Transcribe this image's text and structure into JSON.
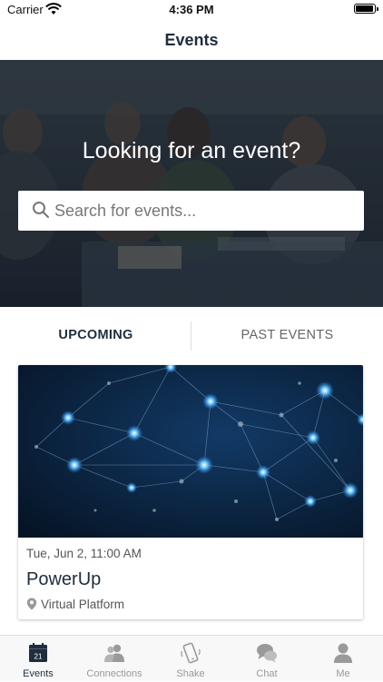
{
  "status_bar": {
    "carrier": "Carrier",
    "time": "4:36 PM"
  },
  "nav": {
    "title": "Events"
  },
  "hero": {
    "headline": "Looking for an event?",
    "search_placeholder": "Search for events..."
  },
  "tabs": [
    {
      "label": "UPCOMING",
      "selected": true
    },
    {
      "label": "PAST EVENTS",
      "selected": false
    }
  ],
  "events": [
    {
      "date": "Tue, Jun 2, 11:00 AM",
      "title": "PowerUp",
      "location": "Virtual Platform"
    }
  ],
  "tab_bar": {
    "items": [
      {
        "label": "Events",
        "icon": "calendar-icon",
        "badge": "21",
        "active": true
      },
      {
        "label": "Connections",
        "icon": "people-icon",
        "active": false
      },
      {
        "label": "Shake",
        "icon": "shake-phone-icon",
        "active": false
      },
      {
        "label": "Chat",
        "icon": "chat-bubbles-icon",
        "active": false
      },
      {
        "label": "Me",
        "icon": "person-icon",
        "active": false
      }
    ]
  },
  "colors": {
    "accent": "#1f2d3d",
    "inactive": "#999999",
    "hero_tint": "#25303a",
    "network_bg": "#0a1f3a"
  }
}
